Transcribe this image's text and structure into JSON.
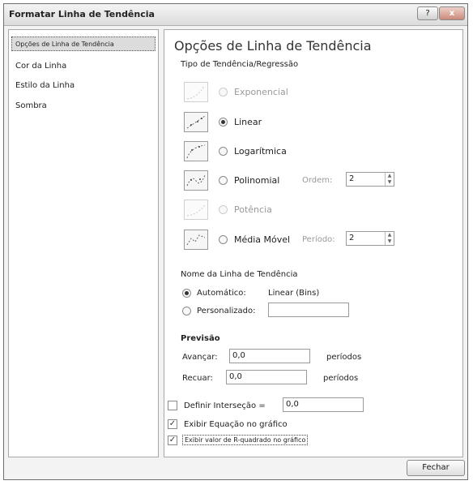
{
  "window": {
    "title": "Formatar Linha de Tendência",
    "help_glyph": "?",
    "close_glyph": "x"
  },
  "sidebar": {
    "items": [
      {
        "label": "Opções de Linha de Tendência"
      },
      {
        "label": "Cor da Linha"
      },
      {
        "label": "Estilo da Linha"
      },
      {
        "label": "Sombra"
      }
    ]
  },
  "panel": {
    "heading": "Opções de Linha de Tendência",
    "trend_type_label": "Tipo de Tendência/Regressão",
    "options": [
      {
        "label": "Exponencial",
        "selected": false,
        "enabled": false
      },
      {
        "label": "Linear",
        "selected": true,
        "enabled": true
      },
      {
        "label": "Logarítmica",
        "selected": false,
        "enabled": true
      },
      {
        "label": "Polinomial",
        "selected": false,
        "enabled": true
      },
      {
        "label": "Potência",
        "selected": false,
        "enabled": false
      },
      {
        "label": "Média Móvel",
        "selected": false,
        "enabled": true
      }
    ],
    "order": {
      "label": "Ordem:",
      "value": "2"
    },
    "period": {
      "label": "Período:",
      "value": "2"
    },
    "name_section": {
      "label": "Nome da Linha de Tendência",
      "auto_label": "Automático:",
      "auto_value": "Linear (Bins)",
      "custom_label": "Personalizado:",
      "custom_value": ""
    },
    "forecast": {
      "label": "Previsão",
      "forward_label": "Avançar:",
      "forward_value": "0,0",
      "backward_label": "Recuar:",
      "backward_value": "0,0",
      "unit": "períodos"
    },
    "intercept": {
      "label": "Definir Interseção =",
      "value": "0,0",
      "checked": false
    },
    "show_equation": {
      "label": "Exibir Equação no gráfico",
      "checked": true
    },
    "show_r2": {
      "label": "Exibir valor de R-quadrado no gráfico",
      "checked": true
    }
  },
  "footer": {
    "close_label": "Fechar"
  }
}
